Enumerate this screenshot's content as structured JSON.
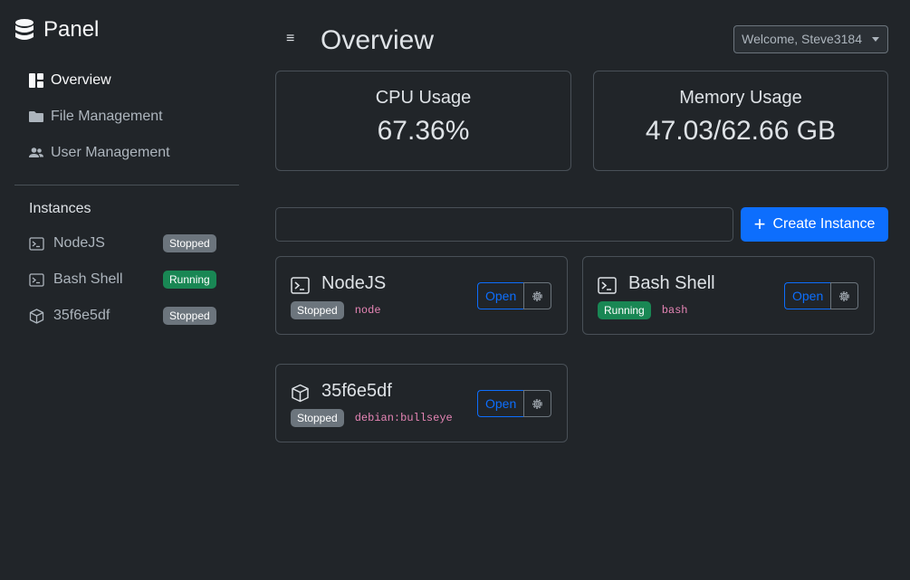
{
  "brand": {
    "name": "Panel",
    "icon": "database-icon"
  },
  "nav": [
    {
      "label": "Overview",
      "icon": "dashboard-icon",
      "active": true
    },
    {
      "label": "File Management",
      "icon": "folder-icon",
      "active": false
    },
    {
      "label": "User Management",
      "icon": "users-icon",
      "active": false
    }
  ],
  "instances_heading": "Instances",
  "sidebar_instances": [
    {
      "label": "NodeJS",
      "icon": "terminal-icon",
      "status": "Stopped"
    },
    {
      "label": "Bash Shell",
      "icon": "terminal-icon",
      "status": "Running"
    },
    {
      "label": "35f6e5df",
      "icon": "box-icon",
      "status": "Stopped"
    }
  ],
  "header": {
    "menu_icon": "≡",
    "title": "Overview",
    "user_menu": "Welcome, Steve3184"
  },
  "stats": {
    "cpu": {
      "label": "CPU Usage",
      "value": "67.36%"
    },
    "memory": {
      "label": "Memory Usage",
      "value": "47.03/62.66 GB"
    }
  },
  "search": {
    "value": "",
    "placeholder": ""
  },
  "create_button": {
    "icon": "+",
    "label": "Create Instance"
  },
  "instance_cards": [
    {
      "name": "NodeJS",
      "icon": "terminal-icon",
      "status": "Stopped",
      "image": "node",
      "open_label": "Open"
    },
    {
      "name": "Bash Shell",
      "icon": "terminal-icon",
      "status": "Running",
      "image": "bash",
      "open_label": "Open"
    },
    {
      "name": "35f6e5df",
      "icon": "box-icon",
      "status": "Stopped",
      "image": "debian:bullseye",
      "open_label": "Open"
    }
  ],
  "colors": {
    "background": "#212529",
    "accent": "#0d6efd",
    "running": "#198754",
    "stopped": "#6c757d",
    "code": "#e685b5"
  }
}
